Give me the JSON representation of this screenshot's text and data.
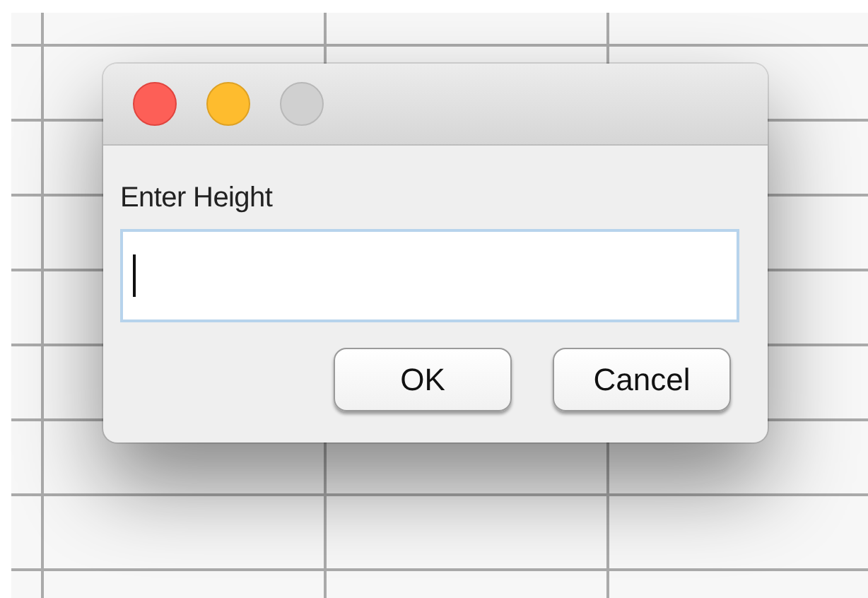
{
  "dialog": {
    "window_controls": [
      {
        "kind": "close",
        "disabled": false
      },
      {
        "kind": "minimize",
        "disabled": false
      },
      {
        "kind": "zoom",
        "disabled": true
      }
    ],
    "label": "Enter Height",
    "field": {
      "focused": true
    },
    "buttons": [
      "OK",
      "Cancel"
    ]
  }
}
